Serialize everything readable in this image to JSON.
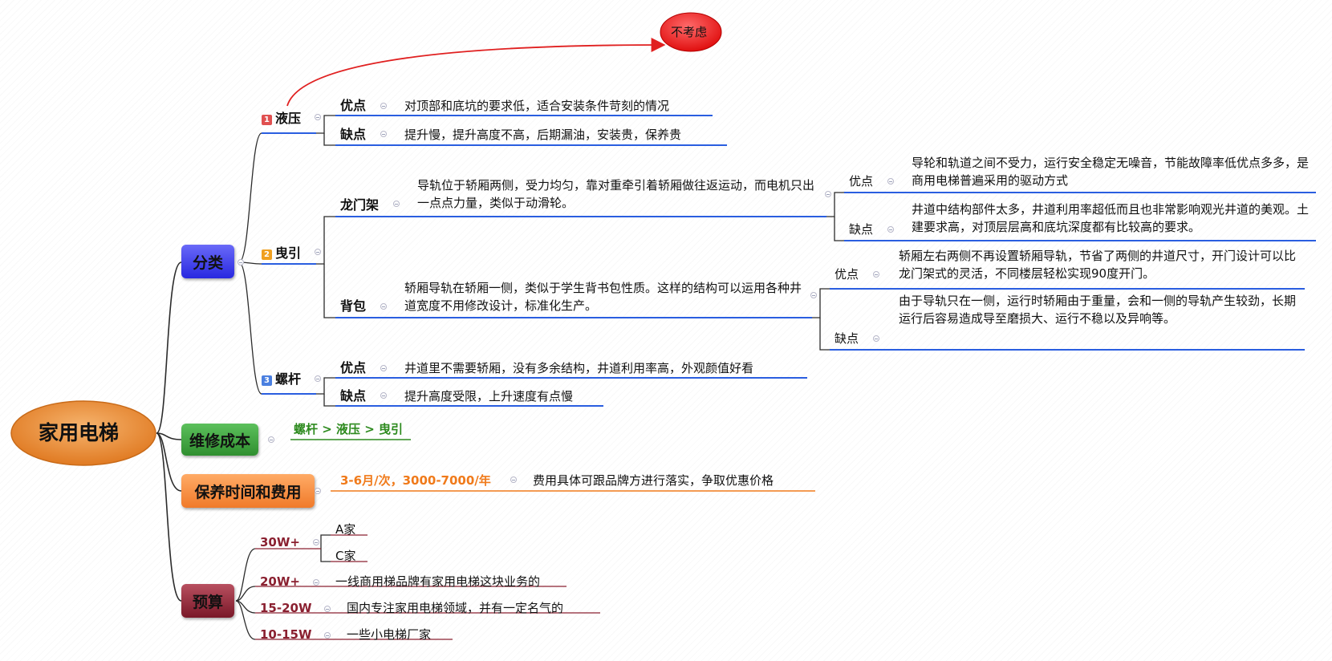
{
  "root": {
    "label": "家用电梯"
  },
  "branches": {
    "classification": {
      "label": "分类",
      "hydraulic": {
        "index": "1",
        "label": "液压",
        "pros_label": "优点",
        "pros_text": "对顶部和底坑的要求低，适合安装条件苛刻的情况",
        "cons_label": "缺点",
        "cons_text": "提升慢，提升高度不高，后期漏油，安装贵，保养贵",
        "callout": "不考虑"
      },
      "traction": {
        "index": "2",
        "label": "曳引",
        "gantry": {
          "label": "龙门架",
          "desc": "导轨位于轿厢两侧，受力均匀，靠对重牵引着轿厢做往返运动，而电机只出一点点力量，类似于动滑轮。",
          "pros_label": "优点",
          "pros_text": "导轮和轨道之间不受力，运行安全稳定无噪音，节能故障率低优点多多，是商用电梯普遍采用的驱动方式",
          "cons_label": "缺点",
          "cons_text": "井道中结构部件太多，井道利用率超低而且也非常影响观光井道的美观。土建要求高，对顶层层高和底坑深度都有比较高的要求。"
        },
        "backpack": {
          "label": "背包",
          "desc": "轿厢导轨在轿厢一侧，类似于学生背书包性质。这样的结构可以运用各种井道宽度不用修改设计，标准化生产。",
          "pros_label": "优点",
          "pros_text": "轿厢左右两侧不再设置轿厢导轨，节省了两侧的井道尺寸，开门设计可以比龙门架式的灵活，不同楼层轻松实现90度开门。",
          "cons_label": "缺点",
          "cons_text": "由于导轨只在一侧，运行时轿厢由于重量，会和一侧的导轨产生较劲，长期运行后容易造成导至磨损大、运行不稳以及异响等。"
        }
      },
      "screw": {
        "index": "3",
        "label": "螺杆",
        "pros_label": "优点",
        "pros_text": "井道里不需要轿厢，没有多余结构，井道利用率高，外观颜值好看",
        "cons_label": "缺点",
        "cons_text": "提升高度受限，上升速度有点慢"
      }
    },
    "repair": {
      "label": "维修成本",
      "value": "螺杆 > 液压 > 曳引"
    },
    "maintenance": {
      "label": "保养时间和费用",
      "value": "3-6月/次，3000-7000/年",
      "note": "费用具体可跟品牌方进行落实，争取优惠价格"
    },
    "budget": {
      "label": "预算",
      "items": [
        {
          "range": "30W+",
          "subs": [
            "A家",
            "C家"
          ]
        },
        {
          "range": "20W+",
          "text": "一线商用梯品牌有家用电梯这块业务的"
        },
        {
          "range": "15-20W",
          "text": "国内专注家用电梯领域，并有一定名气的"
        },
        {
          "range": "10-15W",
          "text": "一些小电梯厂家"
        }
      ]
    }
  },
  "colors": {
    "root": "#ec8f3a",
    "classification": "#3a3af0",
    "repair": "#2f8f2f",
    "maintenance": "#f07a2a",
    "budget": "#8a2030",
    "topic_line": "#2a5ee0",
    "accent_green": "#2d8a1e",
    "accent_orange": "#f07a1a",
    "accent_red": "#e02020",
    "badge_1": "#e05050",
    "badge_2": "#f0a020",
    "badge_3": "#4a7fe0"
  }
}
